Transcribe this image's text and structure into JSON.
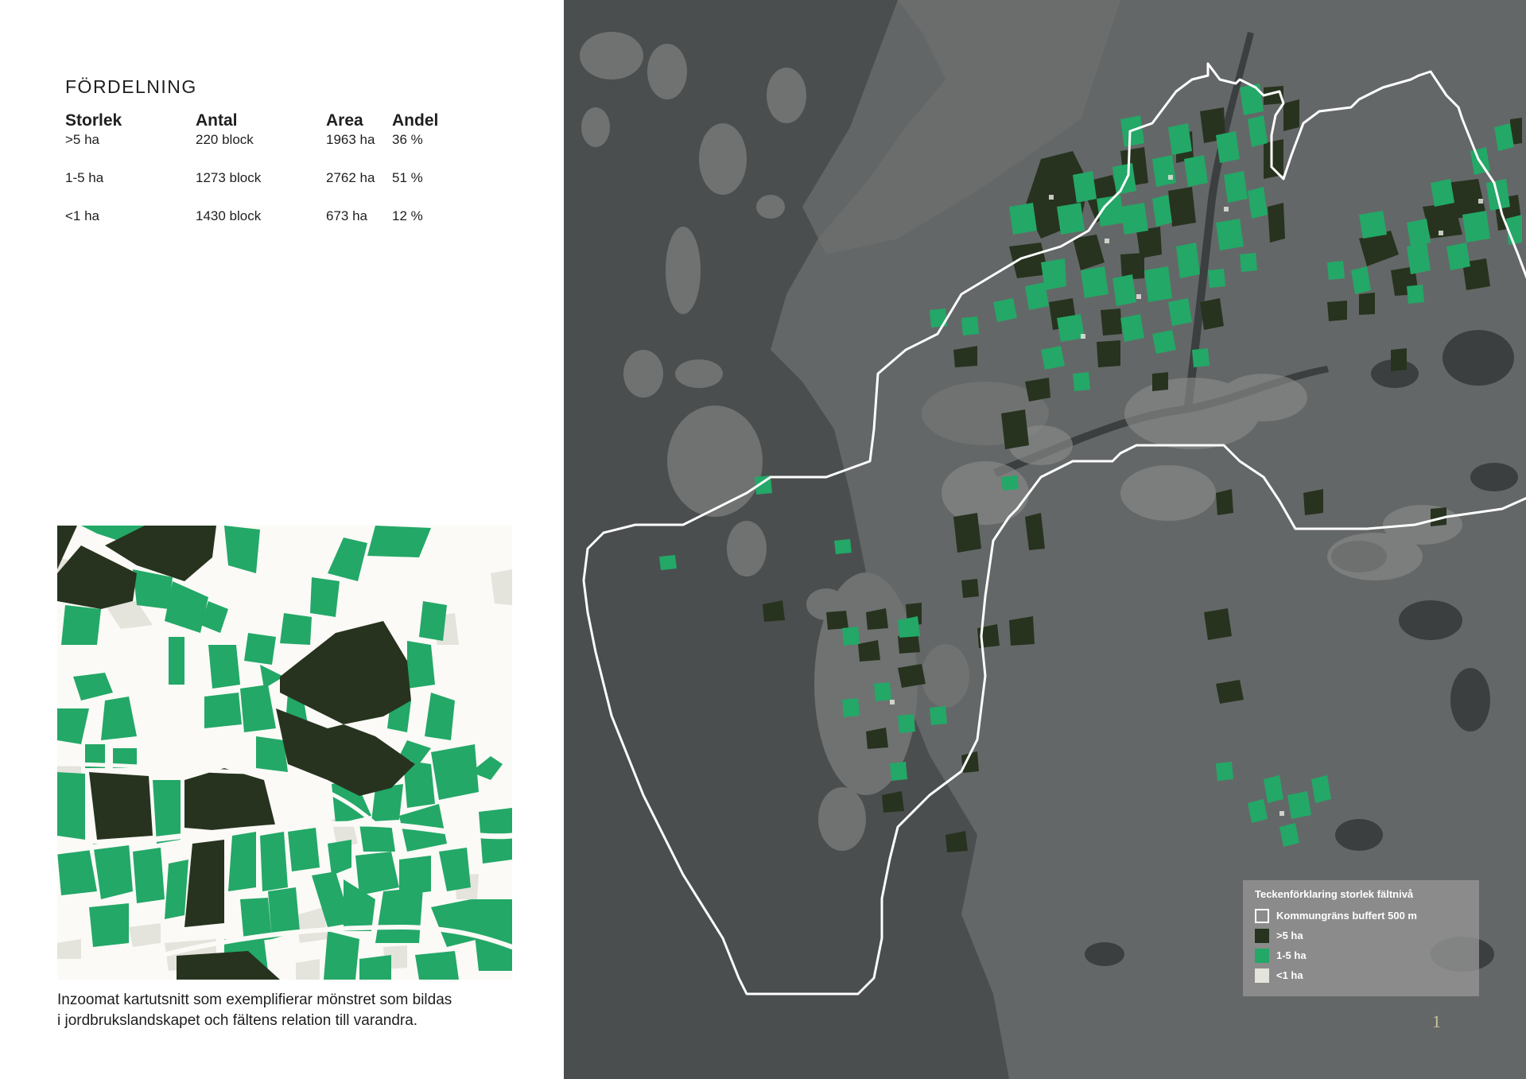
{
  "distribution": {
    "title": "FÖRDELNING",
    "headers": [
      "Storlek",
      "Antal",
      "Area",
      "Andel"
    ],
    "rows": [
      [
        ">5 ha",
        "220 block",
        "1963 ha",
        "36 %"
      ],
      [
        "1-5 ha",
        "1273 block",
        "2762 ha",
        "51 %"
      ],
      [
        "<1 ha",
        "1430 block",
        "673 ha",
        "12 %"
      ]
    ]
  },
  "caption": {
    "line1": "Inzoomat kartutsnitt som exemplifierar mönstret som bildas",
    "line2": "i jordbrukslandskapet och fältens relation till varandra."
  },
  "legend": {
    "title": "Teckenförklaring storlek fältnivå",
    "items": [
      {
        "label": "Kommungräns buffert 500 m",
        "symbol": "outline",
        "color": "#ffffff"
      },
      {
        "label": ">5 ha",
        "symbol": "fill",
        "color": "#27331f"
      },
      {
        "label": "1-5 ha",
        "symbol": "fill",
        "color": "#23a867"
      },
      {
        "label": "<1 ha",
        "symbol": "fill",
        "color": "#e4e3dc"
      }
    ]
  },
  "colors": {
    "large_field": "#27331f",
    "medium_field": "#23a867",
    "small_field": "#e4e3dc",
    "boundary": "#ffffff",
    "satellite_background": "#4b4e4f",
    "zoom_background": "#fbfaf6"
  },
  "page_number": "1"
}
